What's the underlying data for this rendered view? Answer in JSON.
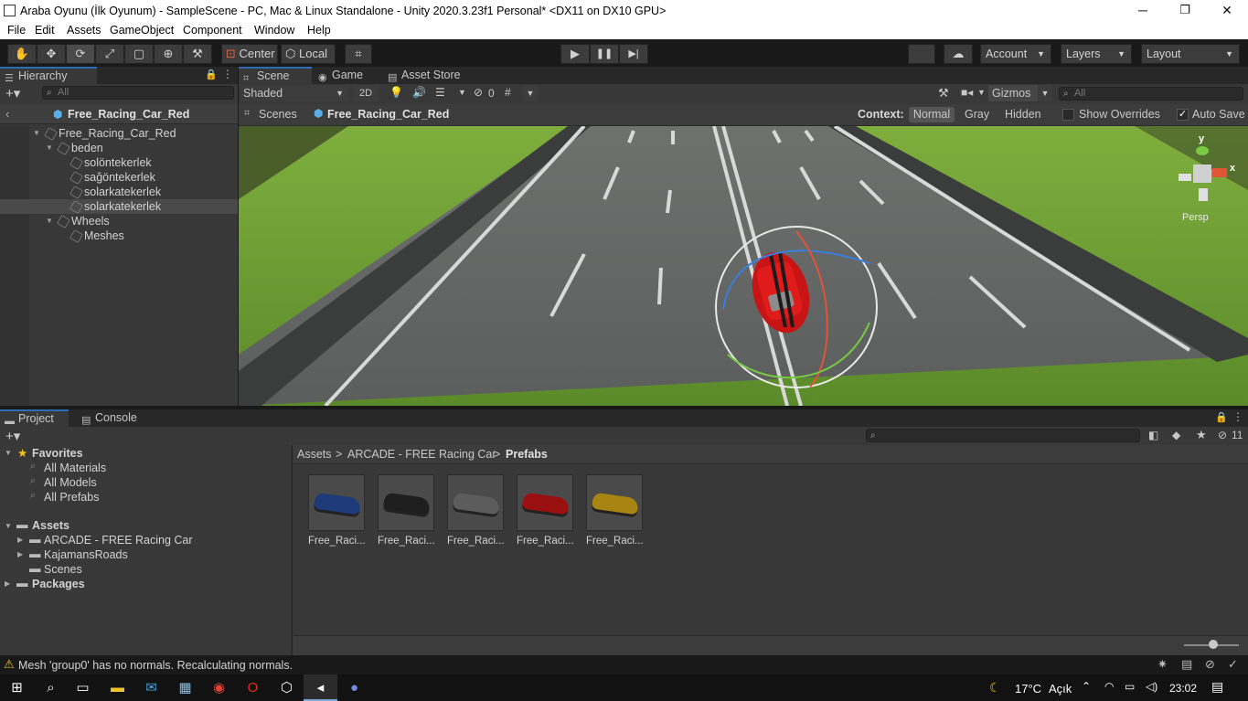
{
  "window": {
    "title": "Araba Oyunu (İlk Oyunum) - SampleScene - PC, Mac & Linux Standalone - Unity 2020.3.23f1 Personal* <DX11 on DX10 GPU>",
    "minimize": "─",
    "maximize": "❐",
    "close": "✕"
  },
  "menu": [
    "File",
    "Edit",
    "Assets",
    "GameObject",
    "Component",
    "Window",
    "Help"
  ],
  "toolbar": {
    "pivot_label": "Center",
    "space_label": "Local",
    "account_label": "Account",
    "layers_label": "Layers",
    "layout_label": "Layout"
  },
  "hierarchy": {
    "tab_label": "Hierarchy",
    "search_placeholder": "All",
    "prefab_title": "Free_Racing_Car_Red",
    "items": [
      {
        "label": "Free_Racing_Car_Red",
        "depth": 0,
        "expanded": true
      },
      {
        "label": "beden",
        "depth": 1,
        "expanded": true
      },
      {
        "label": "solöntekerlek",
        "depth": 2
      },
      {
        "label": "sağöntekerlek",
        "depth": 2
      },
      {
        "label": "solarkatekerlek",
        "depth": 2
      },
      {
        "label": "solarkatekerlek",
        "depth": 2,
        "selected": true
      },
      {
        "label": "Wheels",
        "depth": 1,
        "expanded": true
      },
      {
        "label": "Meshes",
        "depth": 2
      }
    ]
  },
  "scene_tabs": [
    "Scene",
    "Game",
    "Asset Store"
  ],
  "scene_toolbar": {
    "shading": "Shaded",
    "mode_2d": "2D",
    "hidden_count": "0",
    "gizmos_label": "Gizmos",
    "search_placeholder": "All"
  },
  "scene_breadcrumb": {
    "scenes_label": "Scenes",
    "prefab_label": "Free_Racing_Car_Red",
    "context_label": "Context:",
    "context_options": [
      "Normal",
      "Gray",
      "Hidden"
    ],
    "context_selected": "Normal",
    "show_overrides_label": "Show Overrides",
    "show_overrides_checked": false,
    "auto_save_label": "Auto Save",
    "auto_save_checked": true
  },
  "scene_gizmo": {
    "y_label": "y",
    "x_label": "x",
    "persp_label": "Persp"
  },
  "project": {
    "tabs": [
      "Project",
      "Console"
    ],
    "hidden_count": "11",
    "favorites_label": "Favorites",
    "favorites": [
      "All Materials",
      "All Models",
      "All Prefabs"
    ],
    "assets_label": "Assets",
    "asset_folders": [
      "ARCADE - FREE Racing Car",
      "KajamansRoads",
      "Scenes"
    ],
    "packages_label": "Packages",
    "breadcrumb": [
      "Assets",
      "ARCADE - FREE Racing Car",
      "Prefabs"
    ],
    "breadcrumb_sep": ">",
    "prefabs": [
      {
        "name": "Free_Raci...",
        "color": "#1f3a78"
      },
      {
        "name": "Free_Raci...",
        "color": "#1e1e1e"
      },
      {
        "name": "Free_Raci...",
        "color": "#5c5c5c"
      },
      {
        "name": "Free_Raci...",
        "color": "#9a1010"
      },
      {
        "name": "Free_Raci...",
        "color": "#a88412"
      }
    ]
  },
  "status": {
    "message": "Mesh 'group0' has no normals. Recalculating normals."
  },
  "taskbar": {
    "temperature": "17°C",
    "weather": "Açık",
    "time": "23:02"
  },
  "colors": {
    "accent": "#2d6db5",
    "warning": "#f5c518",
    "car_red": "#e01b1b"
  }
}
